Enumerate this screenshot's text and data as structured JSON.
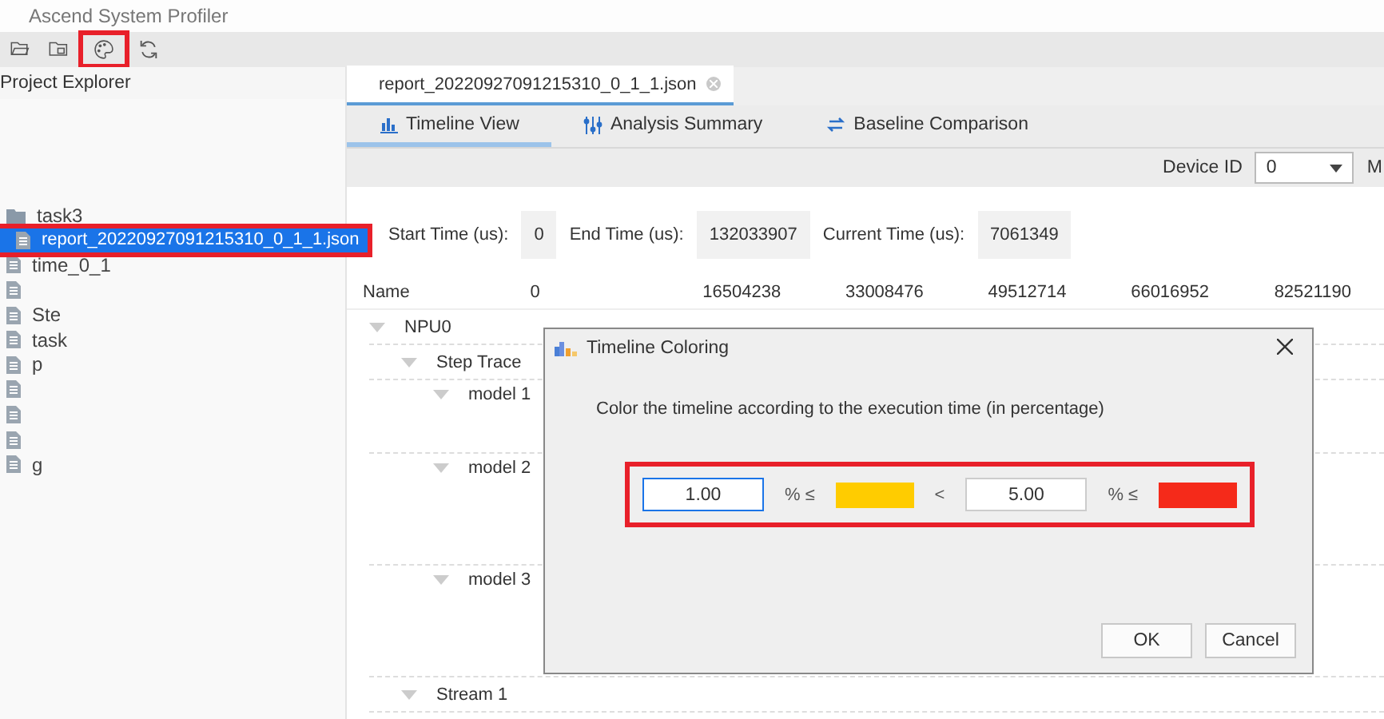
{
  "window": {
    "title": "Ascend System Profiler"
  },
  "toolbar": [
    {
      "kind": "open-folder",
      "highlighted": false
    },
    {
      "kind": "folder-file",
      "highlighted": false
    },
    {
      "kind": "palette",
      "highlighted": true
    },
    {
      "kind": "refresh",
      "highlighted": false
    }
  ],
  "sidebar": {
    "title": "Project Explorer",
    "items": [
      {
        "kind": "folder",
        "label": "task3",
        "selected": false,
        "highlighted": false,
        "children": [
          {
            "kind": "file",
            "label": "report_20220927091215310_0_1_1.json",
            "selected": true,
            "highlighted": true
          }
        ]
      },
      {
        "kind": "file",
        "label": "time_0_1",
        "selected": false,
        "highlighted": false
      },
      {
        "kind": "file",
        "selected": false,
        "highlighted": false
      },
      {
        "kind": "file",
        "label": "Ste",
        "selected": false,
        "highlighted": false
      },
      {
        "kind": "file",
        "label": "task",
        "selected": false,
        "highlighted": false
      },
      {
        "kind": "file",
        "label": "p",
        "selected": false,
        "highlighted": false
      },
      {
        "kind": "file",
        "selected": false,
        "highlighted": false
      },
      {
        "kind": "file",
        "selected": false,
        "highlighted": false
      },
      {
        "kind": "file",
        "selected": false,
        "highlighted": false
      },
      {
        "kind": "file",
        "label": "g",
        "selected": false,
        "highlighted": false
      }
    ]
  },
  "editor": {
    "tabs": [
      {
        "label": "report_20220927091215310_0_1_1.json",
        "selected": true
      }
    ],
    "views": [
      {
        "kind": "timeline",
        "label": "Timeline View",
        "selected": true
      },
      {
        "kind": "summary",
        "label": "Analysis Summary",
        "selected": false
      },
      {
        "kind": "compare",
        "label": "Baseline Comparison",
        "selected": false
      }
    ],
    "device": {
      "label": "Device ID",
      "value": "0",
      "next_label": "M"
    },
    "times": [
      {
        "label": "Start Time (us):",
        "value": "0"
      },
      {
        "label": "End Time (us):",
        "value": "132033907"
      },
      {
        "label": "Current Time (us):",
        "value": "7061349"
      }
    ],
    "timeline": {
      "name_heading": "Name",
      "ticks": [
        "0",
        "16504238",
        "33008476",
        "49512714",
        "66016952",
        "82521190"
      ],
      "lanes": [
        {
          "label": "NPU0",
          "expanded": true,
          "children": [
            {
              "label": "Step Trace",
              "expanded": true,
              "children": [
                {
                  "label": "model 1",
                  "expanded": true
                },
                {
                  "label": "model 2",
                  "expanded": true
                },
                {
                  "label": "model 3",
                  "expanded": true
                }
              ]
            },
            {
              "label": "Stream 1",
              "expanded": true
            }
          ]
        }
      ]
    }
  },
  "dialog": {
    "title": "Timeline Coloring",
    "message": "Color the timeline according to the execution time (in percentage)",
    "highlighted": true,
    "controls": [
      {
        "kind": "input",
        "value": "1.00",
        "focused": true
      },
      {
        "kind": "op",
        "text": "% ≤"
      },
      {
        "kind": "swatch",
        "color": "#ffcc00"
      },
      {
        "kind": "op",
        "text": "<"
      },
      {
        "kind": "input",
        "value": "5.00",
        "focused": false
      },
      {
        "kind": "op",
        "text": "% ≤"
      },
      {
        "kind": "swatch",
        "color": "#f52a1a"
      }
    ],
    "buttons": [
      "OK",
      "Cancel"
    ]
  }
}
